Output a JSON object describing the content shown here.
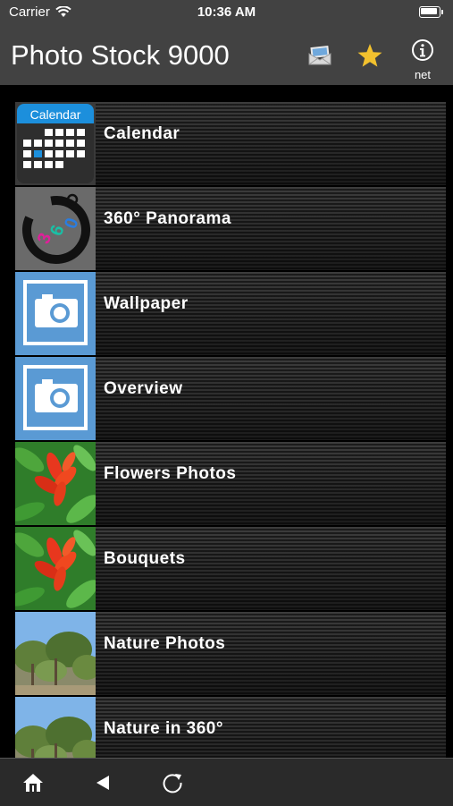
{
  "status_bar": {
    "carrier": "Carrier",
    "time": "10:36 AM"
  },
  "navbar": {
    "title": "Photo Stock 9000",
    "net_label": "net",
    "accent": "#F2C12E"
  },
  "rows": [
    {
      "label": "Calendar",
      "thumb_text": "Calendar",
      "icon": "calendar-icon"
    },
    {
      "label": "360° Panorama",
      "thumb_text": "360",
      "icon": "panorama-360-icon"
    },
    {
      "label": "Wallpaper",
      "icon": "camera-icon"
    },
    {
      "label": "Overview",
      "icon": "camera-icon"
    },
    {
      "label": "Flowers Photos",
      "icon": "flower-photo"
    },
    {
      "label": "Bouquets",
      "icon": "flower-photo"
    },
    {
      "label": "Nature Photos",
      "icon": "nature-photo"
    },
    {
      "label": "Nature in 360°",
      "icon": "nature-photo"
    }
  ]
}
